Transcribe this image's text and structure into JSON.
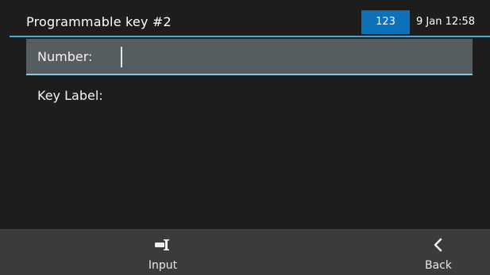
{
  "header": {
    "title": "Programmable key #2",
    "input_mode": "123",
    "datetime": "9 Jan 12:58"
  },
  "form": {
    "number_label": "Number:",
    "number_value": "",
    "key_label_label": "Key Label:",
    "key_label_value": ""
  },
  "softkeys": {
    "input": {
      "label": "Input",
      "icon": "keyboard-input-icon"
    },
    "back": {
      "label": "Back",
      "icon": "chevron-left-icon"
    }
  },
  "colors": {
    "background": "#1d1d1d",
    "accent": "#0b72b9",
    "selected_row": "#565d60",
    "softkey_bar": "#3b3b3b"
  }
}
